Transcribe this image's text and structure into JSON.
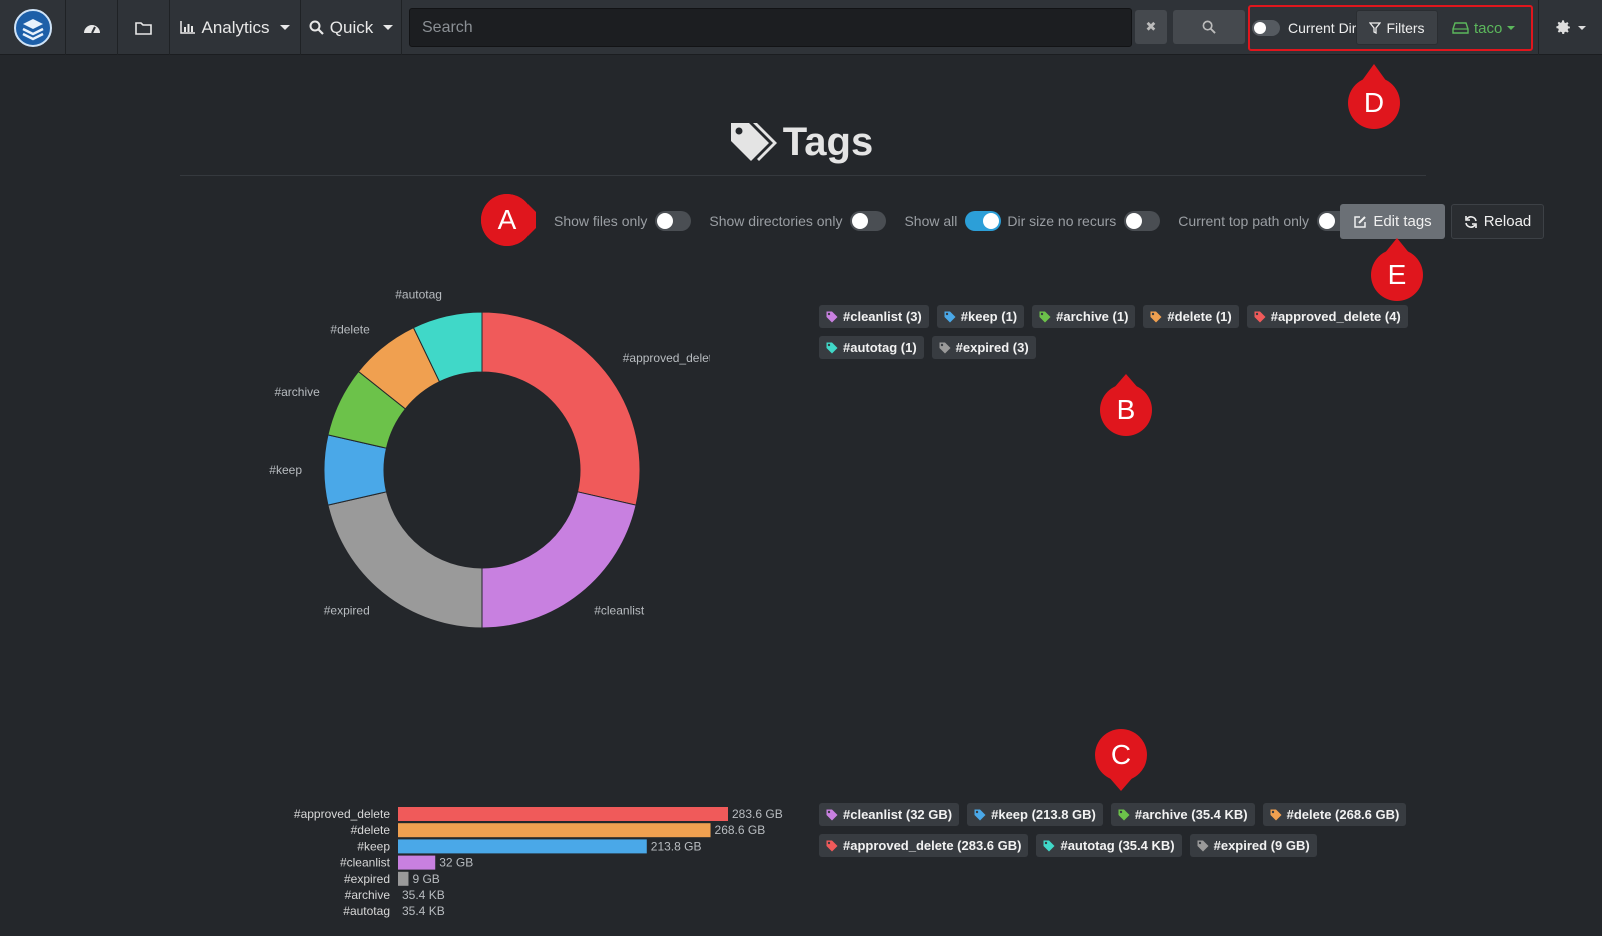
{
  "navbar": {
    "analytics_label": "Analytics",
    "quick_label": "Quick",
    "search_placeholder": "Search",
    "clear_label": "✖",
    "current_dir_label": "Current Dir",
    "filters_label": "Filters",
    "user_label": "taco"
  },
  "page": {
    "title": "Tags"
  },
  "controls": {
    "show_files_only": "Show files only",
    "show_dirs_only": "Show directories only",
    "show_all": "Show all",
    "dir_size_no_recurs": "Dir size no recurs",
    "current_top_path_only": "Current top path only",
    "edit_tags": "Edit tags",
    "reload": "Reload"
  },
  "tag_counts": [
    {
      "label": "#cleanlist (3)",
      "color": "#c880e0"
    },
    {
      "label": "#keep (1)",
      "color": "#4aa8e8"
    },
    {
      "label": "#archive (1)",
      "color": "#6cc24a"
    },
    {
      "label": "#delete (1)",
      "color": "#f0a050"
    },
    {
      "label": "#approved_delete (4)",
      "color": "#f05a5a"
    },
    {
      "label": "#autotag (1)",
      "color": "#40d8c8"
    },
    {
      "label": "#expired (3)",
      "color": "#9a9a9a"
    }
  ],
  "tag_sizes": [
    {
      "label": "#cleanlist (32 GB)",
      "color": "#c880e0"
    },
    {
      "label": "#keep (213.8 GB)",
      "color": "#4aa8e8"
    },
    {
      "label": "#archive (35.4 KB)",
      "color": "#6cc24a"
    },
    {
      "label": "#delete (268.6 GB)",
      "color": "#f0a050"
    },
    {
      "label": "#approved_delete (283.6 GB)",
      "color": "#f05a5a"
    },
    {
      "label": "#autotag (35.4 KB)",
      "color": "#40d8c8"
    },
    {
      "label": "#expired (9 GB)",
      "color": "#9a9a9a"
    }
  ],
  "markers": [
    "A",
    "B",
    "C",
    "D",
    "E"
  ],
  "chart_data": [
    {
      "type": "pie",
      "categories": [
        "#approved_delete",
        "#cleanlist",
        "#expired",
        "#keep",
        "#archive",
        "#delete",
        "#autotag"
      ],
      "values": [
        4,
        3,
        3,
        1,
        1,
        1,
        1
      ],
      "colors": [
        "#f05a5a",
        "#c880e0",
        "#9a9a9a",
        "#4aa8e8",
        "#6cc24a",
        "#f0a050",
        "#40d8c8"
      ],
      "donut": true
    },
    {
      "type": "bar",
      "orientation": "horizontal",
      "categories": [
        "#approved_delete",
        "#delete",
        "#keep",
        "#cleanlist",
        "#expired",
        "#archive",
        "#autotag"
      ],
      "values": [
        283.6,
        268.6,
        213.8,
        32,
        9,
        3.54e-05,
        3.54e-05
      ],
      "value_labels": [
        "283.6 GB",
        "268.6 GB",
        "213.8 GB",
        "32 GB",
        "9 GB",
        "35.4 KB",
        "35.4 KB"
      ],
      "colors": [
        "#f05a5a",
        "#f0a050",
        "#4aa8e8",
        "#c880e0",
        "#9a9a9a",
        "#6cc24a",
        "#40d8c8"
      ],
      "unit": "GB"
    }
  ]
}
